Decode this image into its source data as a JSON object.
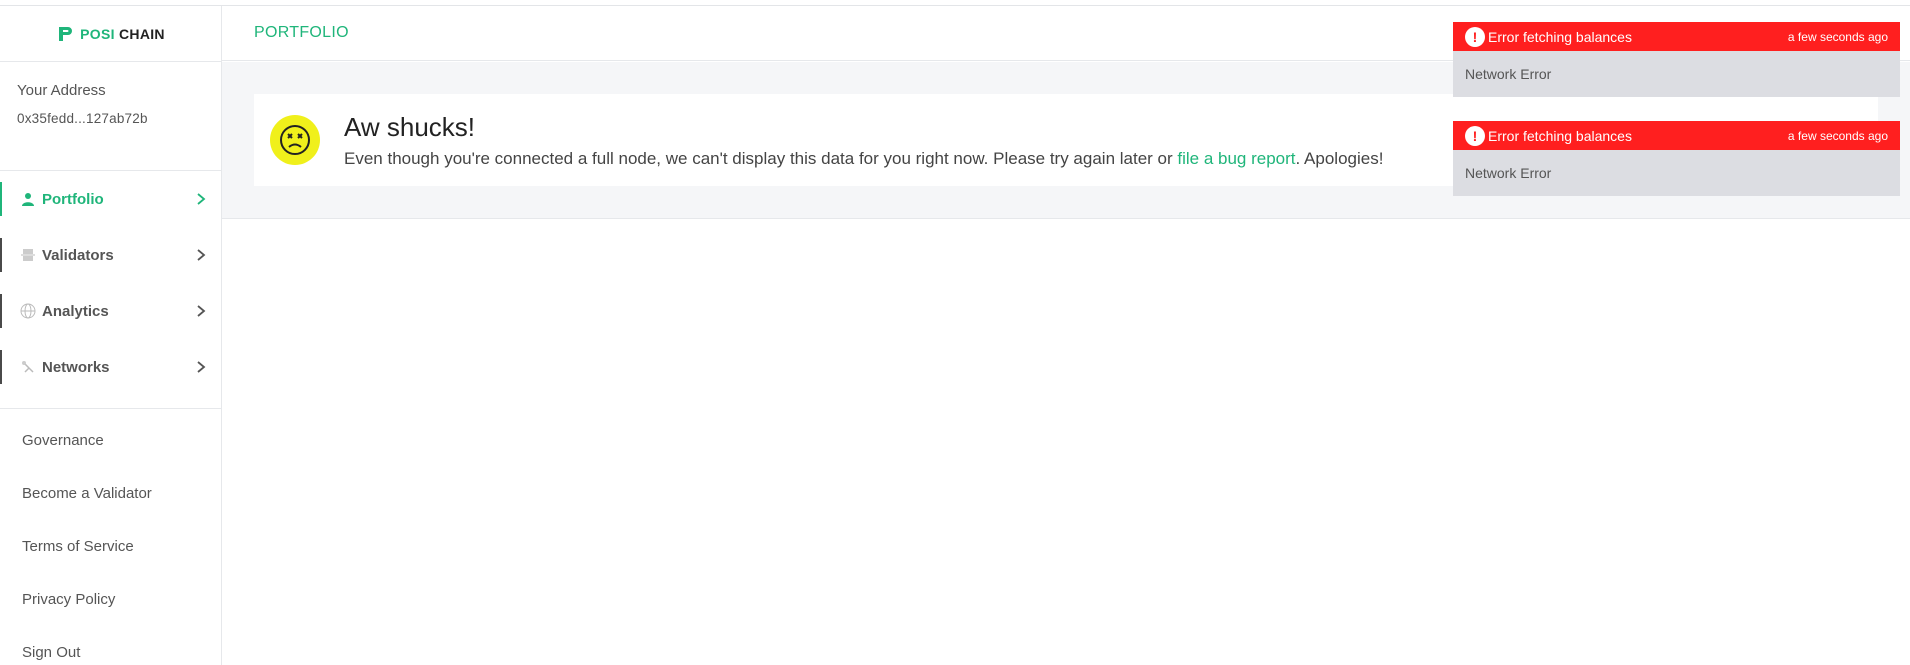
{
  "brand": {
    "part1": "POSI",
    "part2": "CHAIN"
  },
  "account": {
    "label": "Your Address",
    "address": "0x35fedd...127ab72b"
  },
  "nav": [
    {
      "label": "Portfolio",
      "icon": "person-icon",
      "active": true
    },
    {
      "label": "Validators",
      "icon": "server-icon",
      "active": false
    },
    {
      "label": "Analytics",
      "icon": "globe-icon",
      "active": false
    },
    {
      "label": "Networks",
      "icon": "satellite-icon",
      "active": false
    }
  ],
  "links": [
    "Governance",
    "Become a Validator",
    "Terms of Service",
    "Privacy Policy",
    "Sign Out"
  ],
  "header": {
    "title": "PORTFOLIO"
  },
  "error_card": {
    "title": "Aw shucks!",
    "message_before": "Even though you're connected a full node, we can't display this data for you right now. Please try again later or ",
    "link_text": "file a bug report",
    "message_after": ". Apologies!"
  },
  "toasts": [
    {
      "title": "Error fetching balances",
      "time": "a few seconds ago",
      "body": "Network Error"
    },
    {
      "title": "Error fetching balances",
      "time": "a few seconds ago",
      "body": "Network Error"
    }
  ],
  "colors": {
    "accent": "#1fb57a",
    "error": "#ff1f1f",
    "toast_body": "#dcdde2",
    "face": "#f0f01b"
  }
}
